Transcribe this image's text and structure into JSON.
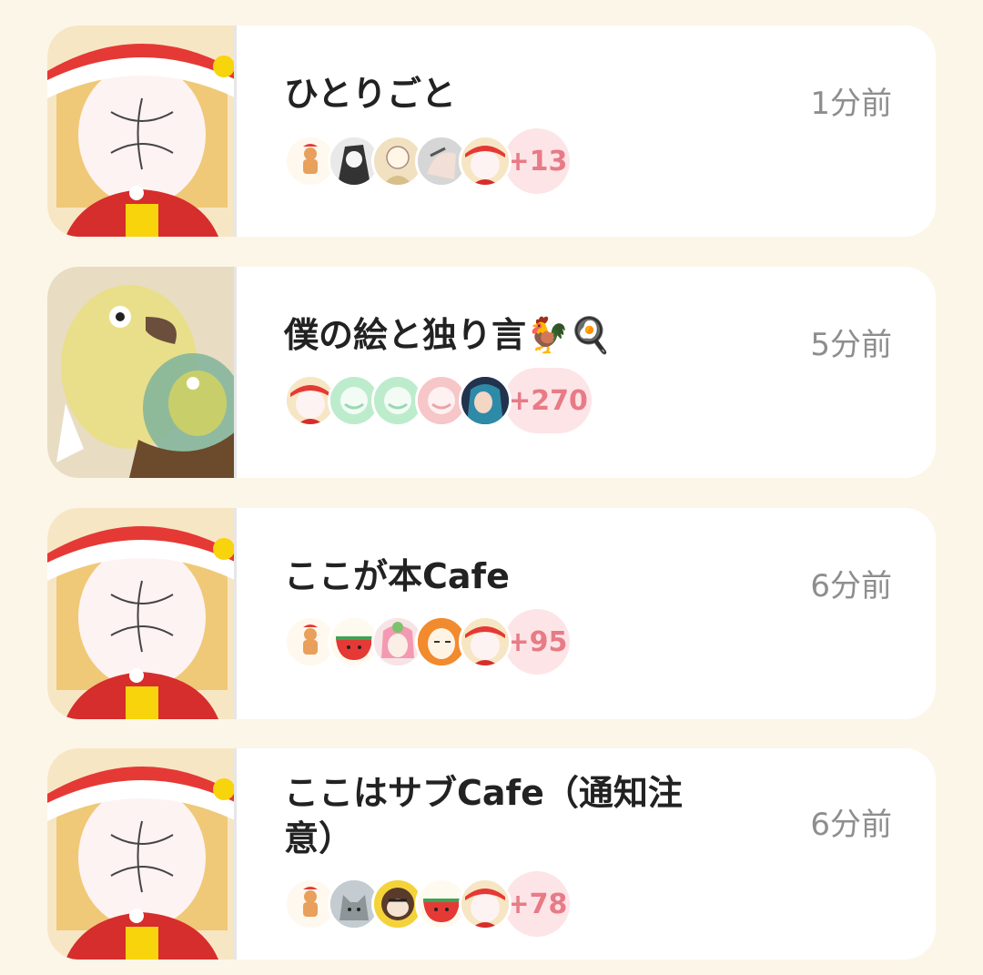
{
  "rooms": [
    {
      "title": "ひとりごと",
      "time": "1分前",
      "extra_members": "+13",
      "thumbnail": "santa-girl-icon",
      "avatars": [
        "gingerbread-avatar-icon",
        "manga-avatar-icon",
        "sketch-avatar-icon",
        "hand-photo-avatar-icon",
        "santa-girl-avatar-icon"
      ]
    },
    {
      "title": "僕の絵と独り言🐓🍳",
      "time": "5分前",
      "extra_members": "+270",
      "thumbnail": "yellow-bird-painting-icon",
      "avatars": [
        "santa-girl-avatar-icon",
        "green-default-avatar-icon",
        "green-default-avatar-icon",
        "pink-default-avatar-icon",
        "blue-hair-avatar-icon"
      ]
    },
    {
      "title": "ここが本Cafe",
      "time": "6分前",
      "extra_members": "+95",
      "thumbnail": "santa-girl-icon",
      "avatars": [
        "gingerbread-avatar-icon",
        "watermelon-avatar-icon",
        "pink-hair-avatar-icon",
        "orange-character-avatar-icon",
        "santa-girl-avatar-icon"
      ]
    },
    {
      "title": "ここはサブCafe（通知注意）",
      "time": "6分前",
      "extra_members": "+78",
      "thumbnail": "santa-girl-icon",
      "avatars": [
        "gingerbread-avatar-icon",
        "cat-photo-avatar-icon",
        "brown-character-avatar-icon",
        "watermelon-avatar-icon",
        "santa-girl-avatar-icon"
      ]
    }
  ],
  "colors": {
    "background": "#fcf6e8",
    "card": "#ffffff",
    "badge_bg": "#fde4e7",
    "badge_text": "#e77b86",
    "time_text": "#8e8e8e"
  }
}
